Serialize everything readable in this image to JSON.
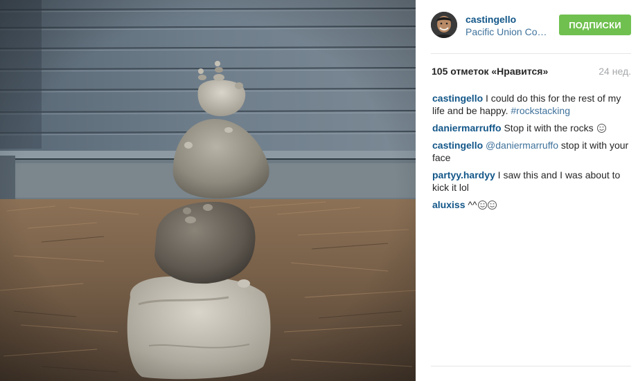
{
  "post": {
    "author": {
      "username": "castingello",
      "location": "Pacific Union College"
    },
    "follow_button_label": "ПОДПИСКИ",
    "likes_label": "105 отметок «Нравится»",
    "date_label": "24 нед.",
    "comments": [
      {
        "user": "castingello",
        "text": " I could do this for the rest of my life and be happy. ",
        "link": "#rockstacking",
        "emoji": []
      },
      {
        "user": "daniermarruffo",
        "text": " Stop it with the rocks ",
        "link": "",
        "emoji": [
          "smiling-face-icon"
        ]
      },
      {
        "user": "castingello",
        "text": "",
        "link": "@daniermarruffo",
        "after_link": " stop it with your face",
        "emoji": []
      },
      {
        "user": "partyy.hardyy",
        "text": " I saw this and I was about to kick it lol",
        "link": "",
        "emoji": []
      },
      {
        "user": "aluxiss",
        "text": " ^^",
        "link": "",
        "emoji": [
          "smiling-face-icon",
          "smiling-face-icon"
        ]
      }
    ],
    "comment_placeholder": ""
  },
  "colors": {
    "username": "#125688",
    "link": "#3f729b",
    "follow_button": "#70c050",
    "muted": "#a5a7aa"
  }
}
